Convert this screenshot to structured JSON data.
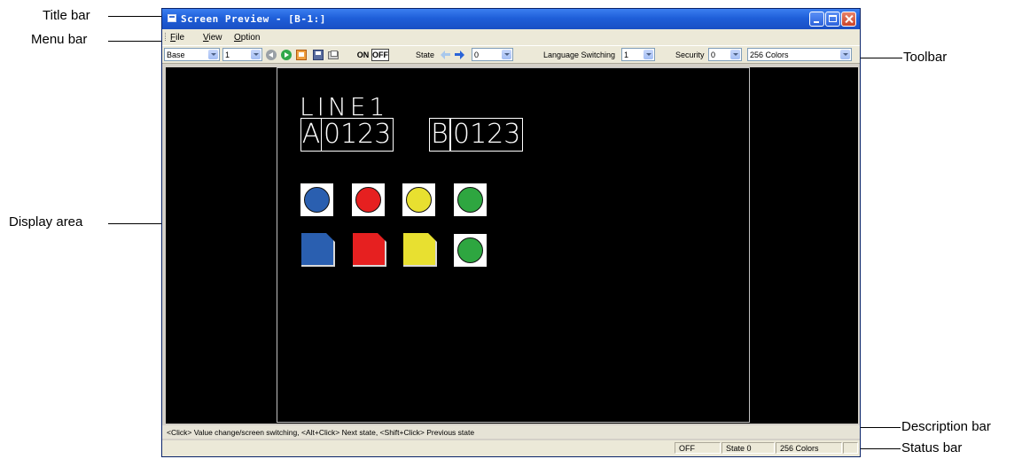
{
  "callouts": {
    "title_bar": "Title bar",
    "menu_bar": "Menu bar",
    "display_area": "Display area",
    "toolbar": "Toolbar",
    "description_bar": "Description bar",
    "status_bar": "Status bar"
  },
  "window": {
    "title": "Screen Preview - [B-1:]"
  },
  "menu": {
    "items": [
      "File",
      "View",
      "Option"
    ]
  },
  "toolbar": {
    "screen_type": "Base",
    "screen_number": "1",
    "on_label": "ON",
    "off_label": "OFF",
    "state_label": "State",
    "state_value": "0",
    "language_label": "Language Switching",
    "language_value": "1",
    "security_label": "Security",
    "security_value": "0",
    "color_mode": "256 Colors"
  },
  "display": {
    "line1": "LINE1",
    "lamp_a": "A",
    "value_a": "0123",
    "lamp_b": "B",
    "value_b": "0123",
    "lamp_colors_row1": [
      "#2a5fb0",
      "#e62020",
      "#e8e030",
      "#2ea640"
    ],
    "lamp_colors_row2": [
      "#2a5fb0",
      "#e62020",
      "#e8e030",
      "#2ea640"
    ]
  },
  "description": {
    "text": "<Click> Value change/screen switching, <Alt+Click> Next state, <Shift+Click> Previous state"
  },
  "status": {
    "onoff": "OFF",
    "state": "State 0",
    "colors": "256 Colors"
  }
}
